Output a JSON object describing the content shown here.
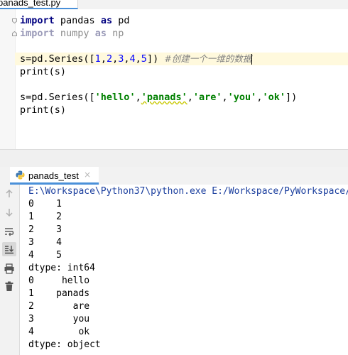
{
  "editor": {
    "tab_label": "panads_test.py",
    "lines": [
      {
        "parts": [
          {
            "t": "import",
            "c": "kw"
          },
          {
            "t": " pandas ",
            "c": ""
          },
          {
            "t": "as",
            "c": "kw"
          },
          {
            "t": " pd",
            "c": ""
          }
        ]
      },
      {
        "parts": [
          {
            "t": "import",
            "c": "kw-dim"
          },
          {
            "t": " numpy ",
            "c": "dim"
          },
          {
            "t": "as",
            "c": "kw-dim"
          },
          {
            "t": " np",
            "c": "dim"
          }
        ]
      },
      {
        "parts": []
      },
      {
        "parts": [
          {
            "t": "s=pd.Series([",
            "c": ""
          },
          {
            "t": "1",
            "c": "num"
          },
          {
            "t": ",",
            "c": ""
          },
          {
            "t": "2",
            "c": "num"
          },
          {
            "t": ",",
            "c": ""
          },
          {
            "t": "3",
            "c": "num"
          },
          {
            "t": ",",
            "c": ""
          },
          {
            "t": "4",
            "c": "num"
          },
          {
            "t": ",",
            "c": ""
          },
          {
            "t": "5",
            "c": "num"
          },
          {
            "t": "]) ",
            "c": ""
          },
          {
            "t": "#创建一个一维的数据",
            "c": "cmt"
          }
        ],
        "highlighted": true,
        "caret": true
      },
      {
        "parts": [
          {
            "t": "print(s)",
            "c": ""
          }
        ]
      },
      {
        "parts": []
      },
      {
        "parts": [
          {
            "t": "s=pd.Series([",
            "c": ""
          },
          {
            "t": "'hello'",
            "c": "str"
          },
          {
            "t": ",",
            "c": ""
          },
          {
            "t": "'panads'",
            "c": "str squiggle"
          },
          {
            "t": ",",
            "c": ""
          },
          {
            "t": "'are'",
            "c": "str"
          },
          {
            "t": ",",
            "c": ""
          },
          {
            "t": "'you'",
            "c": "str"
          },
          {
            "t": ",",
            "c": ""
          },
          {
            "t": "'ok'",
            "c": "str"
          },
          {
            "t": "])",
            "c": ""
          }
        ]
      },
      {
        "parts": [
          {
            "t": "print(s)",
            "c": ""
          }
        ]
      }
    ]
  },
  "run": {
    "tab_label": "panads_test",
    "close_symbol": "×",
    "tools": [
      "up-arrow-icon",
      "down-arrow-icon",
      "soft-wrap-icon",
      "scroll-to-end-icon",
      "print-icon",
      "trash-icon"
    ],
    "output": [
      "E:\\Workspace\\Python37\\python.exe E:/Workspace/PyWorkspace/",
      "0    1",
      "1    2",
      "2    3",
      "3    4",
      "4    5",
      "dtype: int64",
      "0     hello",
      "1    panads",
      "2       are",
      "3       you",
      "4        ok",
      "dtype: object"
    ]
  },
  "colors": {
    "accent": "#4a90d9",
    "keyword": "#000080",
    "string": "#008000",
    "number": "#0000ff",
    "comment": "#808080"
  }
}
